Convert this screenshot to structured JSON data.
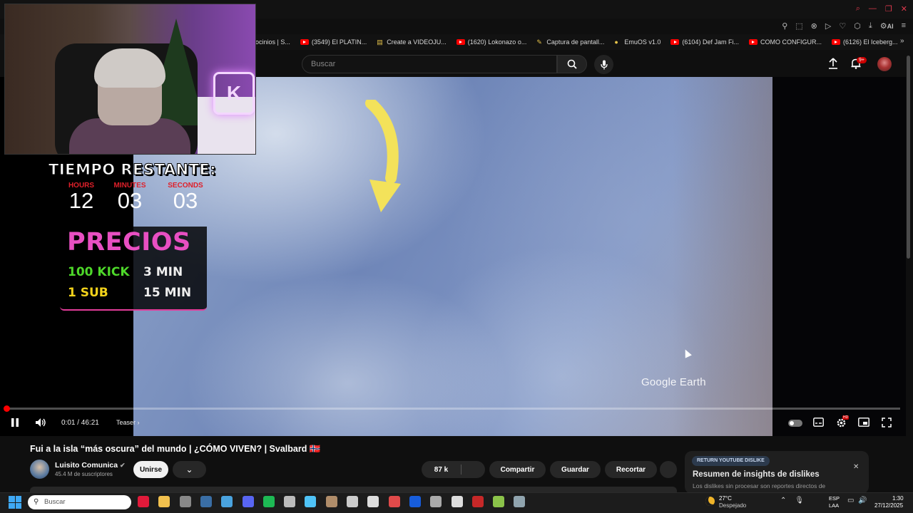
{
  "browser": {
    "bookmarks": [
      {
        "icon": "none",
        "label": "ocinios | S..."
      },
      {
        "icon": "youtube",
        "label": "(3549) El PLATIN..."
      },
      {
        "icon": "doc",
        "label": "Create a VIDEOJU..."
      },
      {
        "icon": "youtube",
        "label": "(1620) Lokonazo o..."
      },
      {
        "icon": "pen",
        "label": "Captura de pantall..."
      },
      {
        "icon": "emu",
        "label": "EmuOS v1.0"
      },
      {
        "icon": "youtube",
        "label": "(6104) Def Jam Fi..."
      },
      {
        "icon": "youtube",
        "label": "COMO CONFIGUR..."
      },
      {
        "icon": "youtube",
        "label": "(6126) El Iceberg..."
      }
    ],
    "top_icons": [
      "pin-icon",
      "screenshot-icon",
      "block-icon",
      "play-icon",
      "heart-icon",
      "extensions-icon",
      "download-icon",
      "ai-icon",
      "menu-icon"
    ],
    "ai_label": "AI"
  },
  "header": {
    "search_placeholder": "Buscar",
    "notification_count": "9+"
  },
  "overlay": {
    "timer_title": "TIEMPO RESTANTE:",
    "timer": [
      {
        "label": "HOURS",
        "value": "12"
      },
      {
        "label": "MINUTES",
        "value": "03"
      },
      {
        "label": "SECONDS",
        "value": "03"
      }
    ],
    "prices_title": "PRECIOS",
    "prices": [
      {
        "item": "100 KICK",
        "duration": "3 MIN",
        "item_color": "#4ed82a"
      },
      {
        "item": "1 SUB",
        "duration": "15 MIN",
        "item_color": "#f2d21b"
      }
    ]
  },
  "video": {
    "watermark": "Google Earth",
    "progress_fraction": 0.0004,
    "current_time": "0:01",
    "duration": "46:21",
    "time_display": "0:01 / 46:21",
    "chapter": "Teaser",
    "settings_badge": "HD"
  },
  "meta": {
    "title": "Fui a la isla “más oscura” del mundo | ¿CÓMO VIVEN? | Svalbard 🇳🇴",
    "channel_name": "Luisito Comunica",
    "subscribers": "45.4 M de suscriptores",
    "join_label": "Unirse",
    "like_count": "87 k",
    "share_label": "Compartir",
    "save_label": "Guardar",
    "clip_label": "Recortar"
  },
  "ryd": {
    "badge": "RETURN YOUTUBE DISLIKE",
    "title": "Resumen de insights de dislikes",
    "subtitle": "Los dislikes sin procesar son reportes directos de"
  },
  "taskbar": {
    "search_placeholder": "Buscar",
    "apps": [
      {
        "name": "opera-gx-icon",
        "color": "#e01a3a"
      },
      {
        "name": "file-explorer-icon",
        "color": "#f2c14e"
      },
      {
        "name": "chrome-icon",
        "color": "#888888"
      },
      {
        "name": "steam-icon",
        "color": "#3a6ea5"
      },
      {
        "name": "shield-app-icon",
        "color": "#4aa3df"
      },
      {
        "name": "discord-icon",
        "color": "#5865f2"
      },
      {
        "name": "spotify-icon",
        "color": "#1db954"
      },
      {
        "name": "dolphin-app-icon",
        "color": "#bbbbbb"
      },
      {
        "name": "notepad-icon",
        "color": "#4fc3f7"
      },
      {
        "name": "game-app-icon",
        "color": "#b08d6a"
      },
      {
        "name": "car-app-icon",
        "color": "#cccccc"
      },
      {
        "name": "g-app-icon",
        "color": "#dddddd"
      },
      {
        "name": "record-app-icon",
        "color": "#e04a4a"
      },
      {
        "name": "bitwarden-icon",
        "color": "#175ddc"
      },
      {
        "name": "pen-app-icon",
        "color": "#aaaaaa"
      },
      {
        "name": "obs-icon",
        "color": "#dddddd"
      },
      {
        "name": "video-editor-icon",
        "color": "#c62828"
      },
      {
        "name": "bluestacks-icon",
        "color": "#8bc34a"
      },
      {
        "name": "screenshot-app-icon",
        "color": "#90a4ae"
      }
    ],
    "weather_temp": "27°C",
    "weather_condition": "Despejado",
    "lang_1": "ESP",
    "lang_2": "LAA",
    "time": "1:30",
    "date": "27/12/2025"
  }
}
